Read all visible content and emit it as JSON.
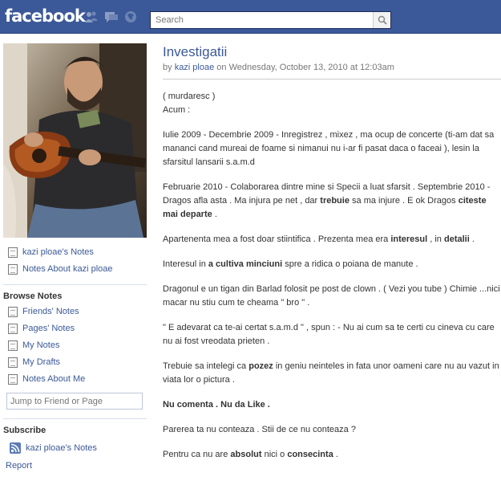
{
  "header": {
    "logo": "facebook",
    "search_placeholder": "Search",
    "icons": [
      "friends-icon",
      "messages-icon",
      "notifications-icon",
      "search-icon"
    ],
    "color_bar": "#3b5998"
  },
  "sidebar": {
    "profile_links": [
      "kazi ploae's Notes",
      "Notes About kazi ploae"
    ],
    "browse_title": "Browse Notes",
    "browse_links": [
      "Friends' Notes",
      "Pages' Notes",
      "My Notes",
      "My Drafts",
      "Notes About Me"
    ],
    "jump_placeholder": "Jump to Friend or Page",
    "subscribe_title": "Subscribe",
    "subscribe_link": "kazi ploae's Notes",
    "report": "Report"
  },
  "note": {
    "title": "Investigatii",
    "by": "by",
    "author": "kazi ploae",
    "date": "on Wednesday, October 13, 2010 at 12:03am",
    "p1_a": "( murdaresc )",
    "p1_b": "Acum :",
    "p2": "Iulie 2009  - Decembrie 2009 - Inregistrez , mixez , ma ocup de concerte (ti-am dat sa mananci cand mureai de foame si nimanui nu i-ar fi pasat daca o faceai ), lesin la sfarsitul lansarii s.a.m.d",
    "p3_a": "Februarie 2010 - Colaborarea dintre mine si Specii a luat sfarsit . Septembrie 2010 - Dragos afla asta . Ma injura pe net , dar",
    "p3_b": "trebuie",
    "p3_c": "sa ma injure . E ok Dragos",
    "p3_d": "citeste mai departe",
    "p3_e": ".",
    "p4_a": "Apartenenta mea a fost doar stiintifica . Prezenta mea era",
    "p4_b": "interesul",
    "p4_c": ", in",
    "p4_d": "detalii",
    "p4_e": ".",
    "p5_a": "Interesul in",
    "p5_b": "a cultiva minciuni",
    "p5_c": "spre a ridica o poiana de manute .",
    "p6": "Dragonul e un tigan din Barlad folosit pe post de clown . ( Vezi you tube ) Chimie ...nici macar nu stiu cum te cheama \" bro \" .",
    "p7": "\" E adevarat ca te-ai certat s.a.m.d \" , spun : - Nu ai cum sa te certi cu cineva cu care nu ai fost vreodata prieten  .",
    "p8_a": "Trebuie sa intelegi ca",
    "p8_b": "pozez",
    "p8_c": "in geniu neinteles in fata unor oameni care nu au vazut in viata lor o pictura .",
    "p9": "Nu comenta . Nu da Like .",
    "p10": "Parerea ta nu conteaza . Stii de ce nu conteaza ?",
    "p11_a": "Pentru ca nu are",
    "p11_b": "absolut",
    "p11_c": "nici o",
    "p11_d": "consecinta",
    "p11_e": "."
  }
}
